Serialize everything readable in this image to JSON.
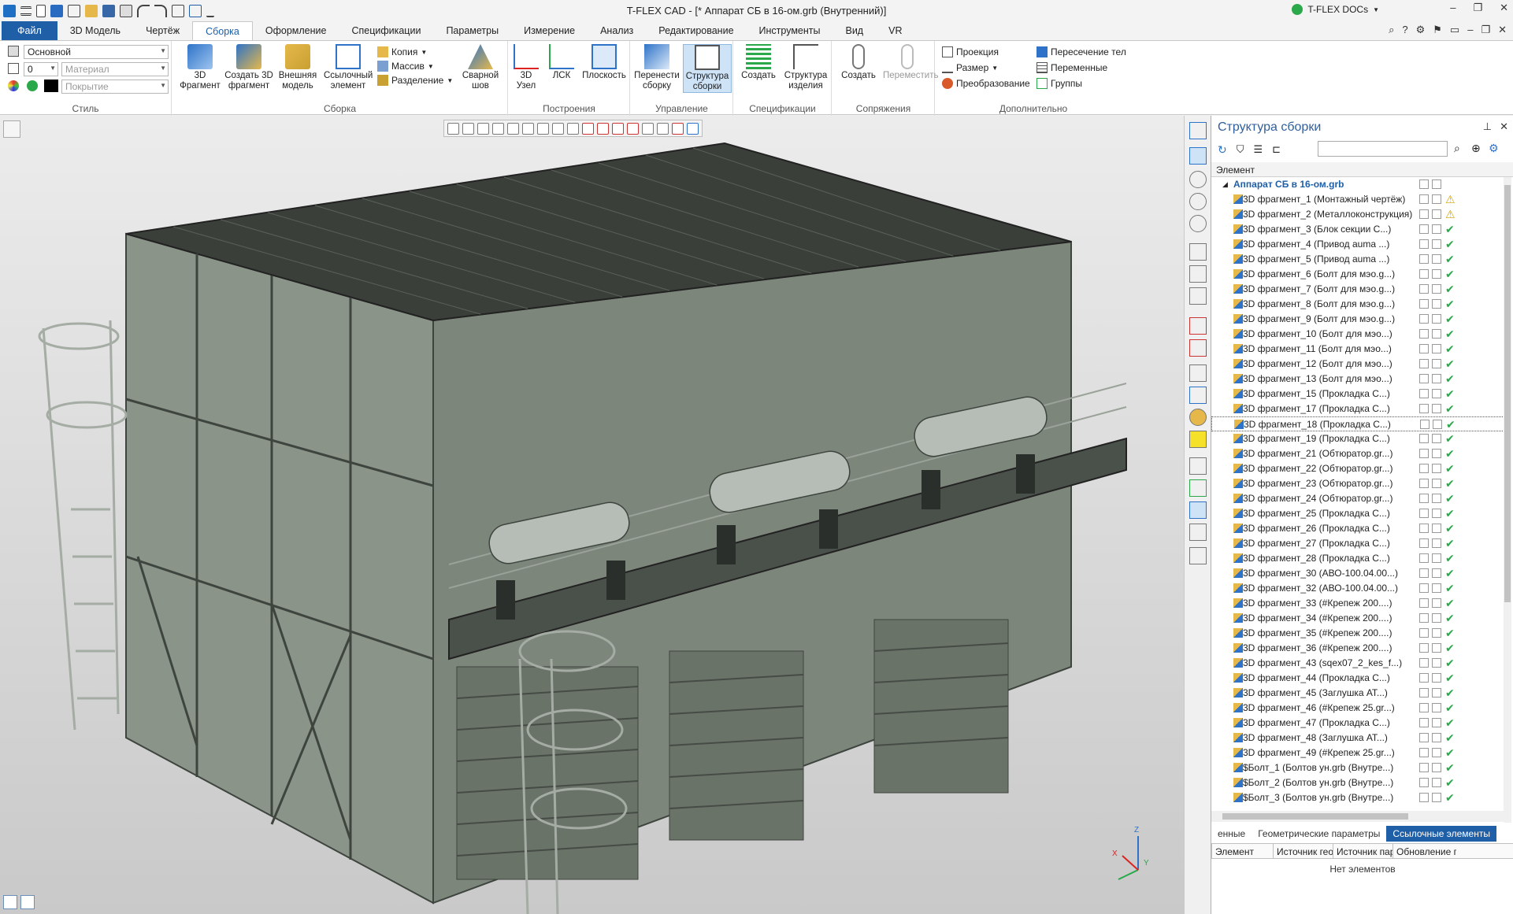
{
  "titlebar": {
    "title": "T-FLEX CAD - [* Аппарат СБ в 16-ом.grb (Внутренний)]",
    "docs_label": "T-FLEX DOCs"
  },
  "tabs": [
    "Файл",
    "3D Модель",
    "Чертёж",
    "Сборка",
    "Оформление",
    "Спецификации",
    "Параметры",
    "Измерение",
    "Анализ",
    "Редактирование",
    "Инструменты",
    "Вид",
    "VR"
  ],
  "ribbon": {
    "style": {
      "label": "Стиль",
      "layer": "Основной",
      "level": "0",
      "material_placeholder": "Материал",
      "coating_placeholder": "Покрытие"
    },
    "assembly": {
      "label": "Сборка",
      "fragment3d": "3D\nФрагмент",
      "create_fragment": "Создать 3D\nфрагмент",
      "external_model": "Внешняя\nмодель",
      "link_element": "Ссылочный\nэлемент",
      "copy": "Копия",
      "array": "Массив",
      "split": "Разделение",
      "weld_seam": "Сварной\nшов"
    },
    "build": {
      "label": "Построения",
      "node3d": "3D\nУзел",
      "lsk": "ЛСК",
      "plane": "Плоскость"
    },
    "manage": {
      "label": "Управление",
      "move_assembly": "Перенести\nсборку",
      "assembly_structure": "Структура\nсборки"
    },
    "spec": {
      "label": "Спецификации",
      "create": "Создать",
      "product_structure": "Структура\nизделия"
    },
    "mates": {
      "label": "Сопряжения",
      "create": "Создать",
      "move": "Переместить"
    },
    "extra": {
      "label": "Дополнительно",
      "projection": "Проекция",
      "size": "Размер",
      "transform": "Преобразование",
      "body_intersection": "Пересечение тел",
      "variables": "Переменные",
      "groups": "Группы"
    }
  },
  "panel": {
    "title": "Структура сборки",
    "column_element": "Элемент",
    "tree": [
      {
        "name": "Аппарат СБ в 16-ом.grb",
        "root": true,
        "mark": ""
      },
      {
        "name": "3D фрагмент_1 (Монтажный чертёж)",
        "mark": "warn"
      },
      {
        "name": "3D фрагмент_2 (Металлоконструкция)",
        "mark": "warn"
      },
      {
        "name": "3D фрагмент_3 (Блок секции С...)",
        "mark": "ok"
      },
      {
        "name": "3D фрагмент_4 (Привод auma ...)",
        "mark": "ok"
      },
      {
        "name": "3D фрагмент_5 (Привод auma ...)",
        "mark": "ok"
      },
      {
        "name": "3D фрагмент_6 (Болт для мэо.g...)",
        "mark": "ok"
      },
      {
        "name": "3D фрагмент_7 (Болт для мэо.g...)",
        "mark": "ok"
      },
      {
        "name": "3D фрагмент_8 (Болт для мэо.g...)",
        "mark": "ok"
      },
      {
        "name": "3D фрагмент_9 (Болт для мэо.g...)",
        "mark": "ok"
      },
      {
        "name": "3D фрагмент_10 (Болт для мэо...)",
        "mark": "ok"
      },
      {
        "name": "3D фрагмент_11 (Болт для мэо...)",
        "mark": "ok"
      },
      {
        "name": "3D фрагмент_12 (Болт для мэо...)",
        "mark": "ok"
      },
      {
        "name": "3D фрагмент_13 (Болт для мэо...)",
        "mark": "ok"
      },
      {
        "name": "3D фрагмент_15 (Прокладка С...)",
        "mark": "ok"
      },
      {
        "name": "3D фрагмент_17 (Прокладка С...)",
        "mark": "ok"
      },
      {
        "name": "3D фрагмент_18 (Прокладка С...)",
        "mark": "ok",
        "sel": true
      },
      {
        "name": "3D фрагмент_19 (Прокладка С...)",
        "mark": "ok"
      },
      {
        "name": "3D фрагмент_21 (Обтюратор.gr...)",
        "mark": "ok"
      },
      {
        "name": "3D фрагмент_22 (Обтюратор.gr...)",
        "mark": "ok"
      },
      {
        "name": "3D фрагмент_23 (Обтюратор.gr...)",
        "mark": "ok"
      },
      {
        "name": "3D фрагмент_24 (Обтюратор.gr...)",
        "mark": "ok"
      },
      {
        "name": "3D фрагмент_25 (Прокладка С...)",
        "mark": "ok"
      },
      {
        "name": "3D фрагмент_26 (Прокладка С...)",
        "mark": "ok"
      },
      {
        "name": "3D фрагмент_27 (Прокладка С...)",
        "mark": "ok"
      },
      {
        "name": "3D фрагмент_28 (Прокладка С...)",
        "mark": "ok"
      },
      {
        "name": "3D фрагмент_30 (АВО-100.04.00...)",
        "mark": "ok"
      },
      {
        "name": "3D фрагмент_32 (АВО-100.04.00...)",
        "mark": "ok"
      },
      {
        "name": "3D фрагмент_33 (#Крепеж 200....)",
        "mark": "ok"
      },
      {
        "name": "3D фрагмент_34 (#Крепеж 200....)",
        "mark": "ok"
      },
      {
        "name": "3D фрагмент_35 (#Крепеж 200....)",
        "mark": "ok"
      },
      {
        "name": "3D фрагмент_36 (#Крепеж 200....)",
        "mark": "ok"
      },
      {
        "name": "3D фрагмент_43 (sqex07_2_kes_f...)",
        "mark": "ok"
      },
      {
        "name": "3D фрагмент_44 (Прокладка С...)",
        "mark": "ok"
      },
      {
        "name": "3D фрагмент_45 (Заглушка АТ...)",
        "mark": "ok"
      },
      {
        "name": "3D фрагмент_46 (#Крепеж 25.gr...)",
        "mark": "ok"
      },
      {
        "name": "3D фрагмент_47 (Прокладка С...)",
        "mark": "ok"
      },
      {
        "name": "3D фрагмент_48 (Заглушка АТ...)",
        "mark": "ok"
      },
      {
        "name": "3D фрагмент_49 (#Крепеж 25.gr...)",
        "mark": "ok"
      },
      {
        "name": "$Болт_1 (Болтов ун.grb (Внутре...)",
        "mark": "ok"
      },
      {
        "name": "$Болт_2 (Болтов ун.grb (Внутре...)",
        "mark": "ok"
      },
      {
        "name": "$Болт_3 (Болтов ун.grb (Внутре...)",
        "mark": "ok"
      }
    ],
    "bottom_tabs": [
      "енные",
      "Геометрические параметры",
      "Ссылочные элементы"
    ],
    "props_columns": [
      "Элемент",
      "Источник гео...",
      "Источник пар...",
      "Обновление г..."
    ],
    "props_empty": "Нет элементов"
  },
  "axes": {
    "z": "Z",
    "y": "Y",
    "x": "X"
  }
}
